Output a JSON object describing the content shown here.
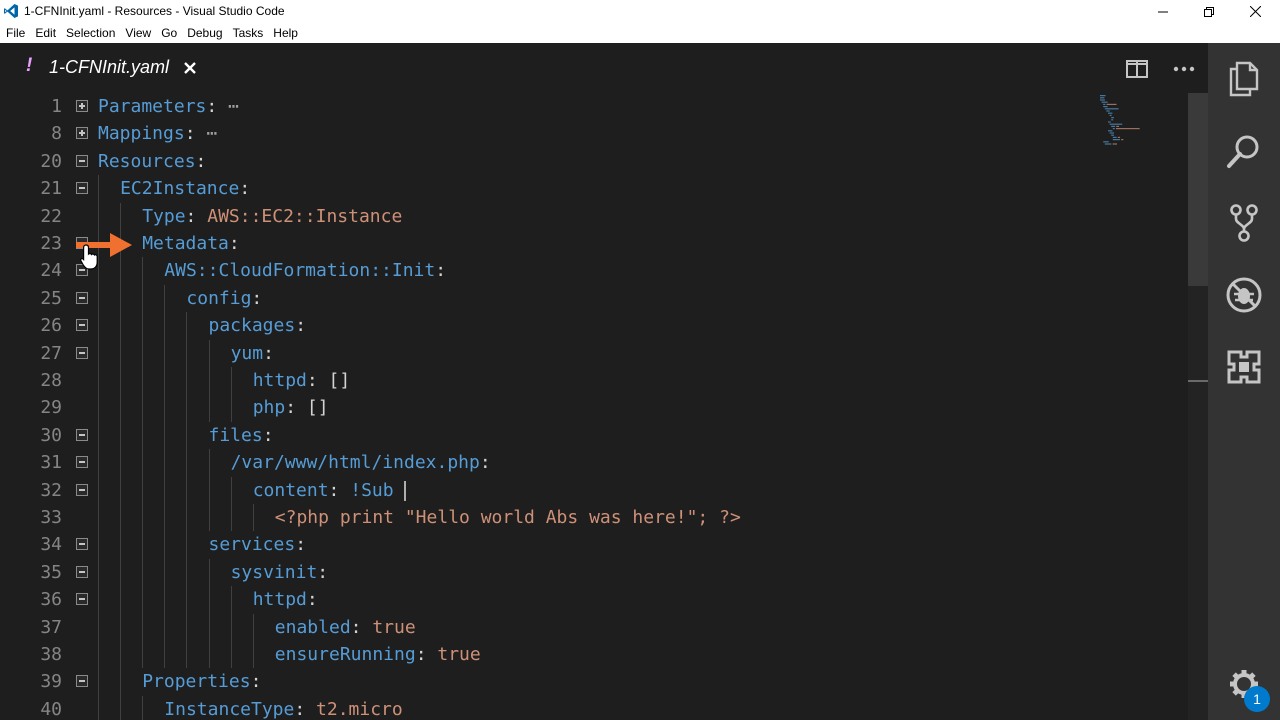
{
  "window": {
    "title": "1-CFNInit.yaml - Resources - Visual Studio Code",
    "app_icon": "vscode-logo-icon"
  },
  "menu": [
    "File",
    "Edit",
    "Selection",
    "View",
    "Go",
    "Debug",
    "Tasks",
    "Help"
  ],
  "tab": {
    "modified_marker": "!",
    "label": "1-CFNInit.yaml"
  },
  "editor_actions": [
    "split-editor-icon",
    "more-actions-icon"
  ],
  "activity_bar": {
    "items": [
      "explorer-icon",
      "search-icon",
      "source-control-icon",
      "debug-icon",
      "extensions-icon"
    ],
    "settings_icon": "gear-icon",
    "settings_badge": "1"
  },
  "colors": {
    "key": "#569cd6",
    "string": "#ce9178",
    "line_number": "#858585",
    "background": "#1e1e1e",
    "activity_bar": "#333333",
    "arrow": "#f07030",
    "badge": "#007acc"
  },
  "code": [
    {
      "num": "1",
      "fold": "collapsed",
      "indent": 0,
      "key": "Parameters",
      "sep": ":",
      "value": "",
      "ellipsis": " ⋯"
    },
    {
      "num": "8",
      "fold": "collapsed",
      "indent": 0,
      "key": "Mappings",
      "sep": ":",
      "value": "",
      "ellipsis": " ⋯"
    },
    {
      "num": "20",
      "fold": "expanded",
      "indent": 0,
      "key": "Resources",
      "sep": ":",
      "value": "",
      "ellipsis": ""
    },
    {
      "num": "21",
      "fold": "expanded",
      "indent": 1,
      "key": "EC2Instance",
      "sep": ":",
      "value": "",
      "ellipsis": ""
    },
    {
      "num": "22",
      "fold": "",
      "indent": 2,
      "key": "Type",
      "sep": ": ",
      "value": "AWS::EC2::Instance",
      "ellipsis": ""
    },
    {
      "num": "23",
      "fold": "expanded",
      "indent": 2,
      "key": "Metadata",
      "sep": ":",
      "value": "",
      "ellipsis": ""
    },
    {
      "num": "24",
      "fold": "expanded",
      "indent": 3,
      "key": "AWS::CloudFormation::Init",
      "sep": ":",
      "value": "",
      "ellipsis": ""
    },
    {
      "num": "25",
      "fold": "expanded",
      "indent": 4,
      "key": "config",
      "sep": ":",
      "value": "",
      "ellipsis": ""
    },
    {
      "num": "26",
      "fold": "expanded",
      "indent": 5,
      "key": "packages",
      "sep": ":",
      "value": "",
      "ellipsis": ""
    },
    {
      "num": "27",
      "fold": "expanded",
      "indent": 6,
      "key": "yum",
      "sep": ":",
      "value": "",
      "ellipsis": ""
    },
    {
      "num": "28",
      "fold": "",
      "indent": 7,
      "key": "httpd",
      "sep": ": []",
      "value": "",
      "ellipsis": ""
    },
    {
      "num": "29",
      "fold": "",
      "indent": 7,
      "key": "php",
      "sep": ": []",
      "value": "",
      "ellipsis": ""
    },
    {
      "num": "30",
      "fold": "expanded",
      "indent": 5,
      "key": "files",
      "sep": ":",
      "value": "",
      "ellipsis": ""
    },
    {
      "num": "31",
      "fold": "expanded",
      "indent": 6,
      "key": "/var/www/html/index.php",
      "sep": ":",
      "value": "",
      "ellipsis": ""
    },
    {
      "num": "32",
      "fold": "expanded",
      "indent": 7,
      "key": "content",
      "sep": ": ",
      "value": "!Sub ",
      "ellipsis": ""
    },
    {
      "num": "33",
      "fold": "",
      "indent": 8,
      "key": "",
      "sep": "",
      "value": "<?php print \"Hello world Abs was here!\"; ?>",
      "ellipsis": ""
    },
    {
      "num": "34",
      "fold": "expanded",
      "indent": 5,
      "key": "services",
      "sep": ":",
      "value": "",
      "ellipsis": ""
    },
    {
      "num": "35",
      "fold": "expanded",
      "indent": 6,
      "key": "sysvinit",
      "sep": ":",
      "value": "",
      "ellipsis": ""
    },
    {
      "num": "36",
      "fold": "expanded",
      "indent": 7,
      "key": "httpd",
      "sep": ":",
      "value": "",
      "ellipsis": ""
    },
    {
      "num": "37",
      "fold": "",
      "indent": 8,
      "key": "enabled",
      "sep": ": ",
      "value": "true",
      "ellipsis": ""
    },
    {
      "num": "38",
      "fold": "",
      "indent": 8,
      "key": "ensureRunning",
      "sep": ": ",
      "value": "true",
      "ellipsis": ""
    },
    {
      "num": "39",
      "fold": "expanded",
      "indent": 2,
      "key": "Properties",
      "sep": ":",
      "value": "",
      "ellipsis": ""
    },
    {
      "num": "40",
      "fold": "",
      "indent": 3,
      "key": "InstanceType",
      "sep": ": ",
      "value": "t2.micro",
      "ellipsis": ""
    }
  ],
  "cursor_line": "32",
  "annotation": {
    "type": "arrow-icon",
    "points_to_line": "23"
  }
}
